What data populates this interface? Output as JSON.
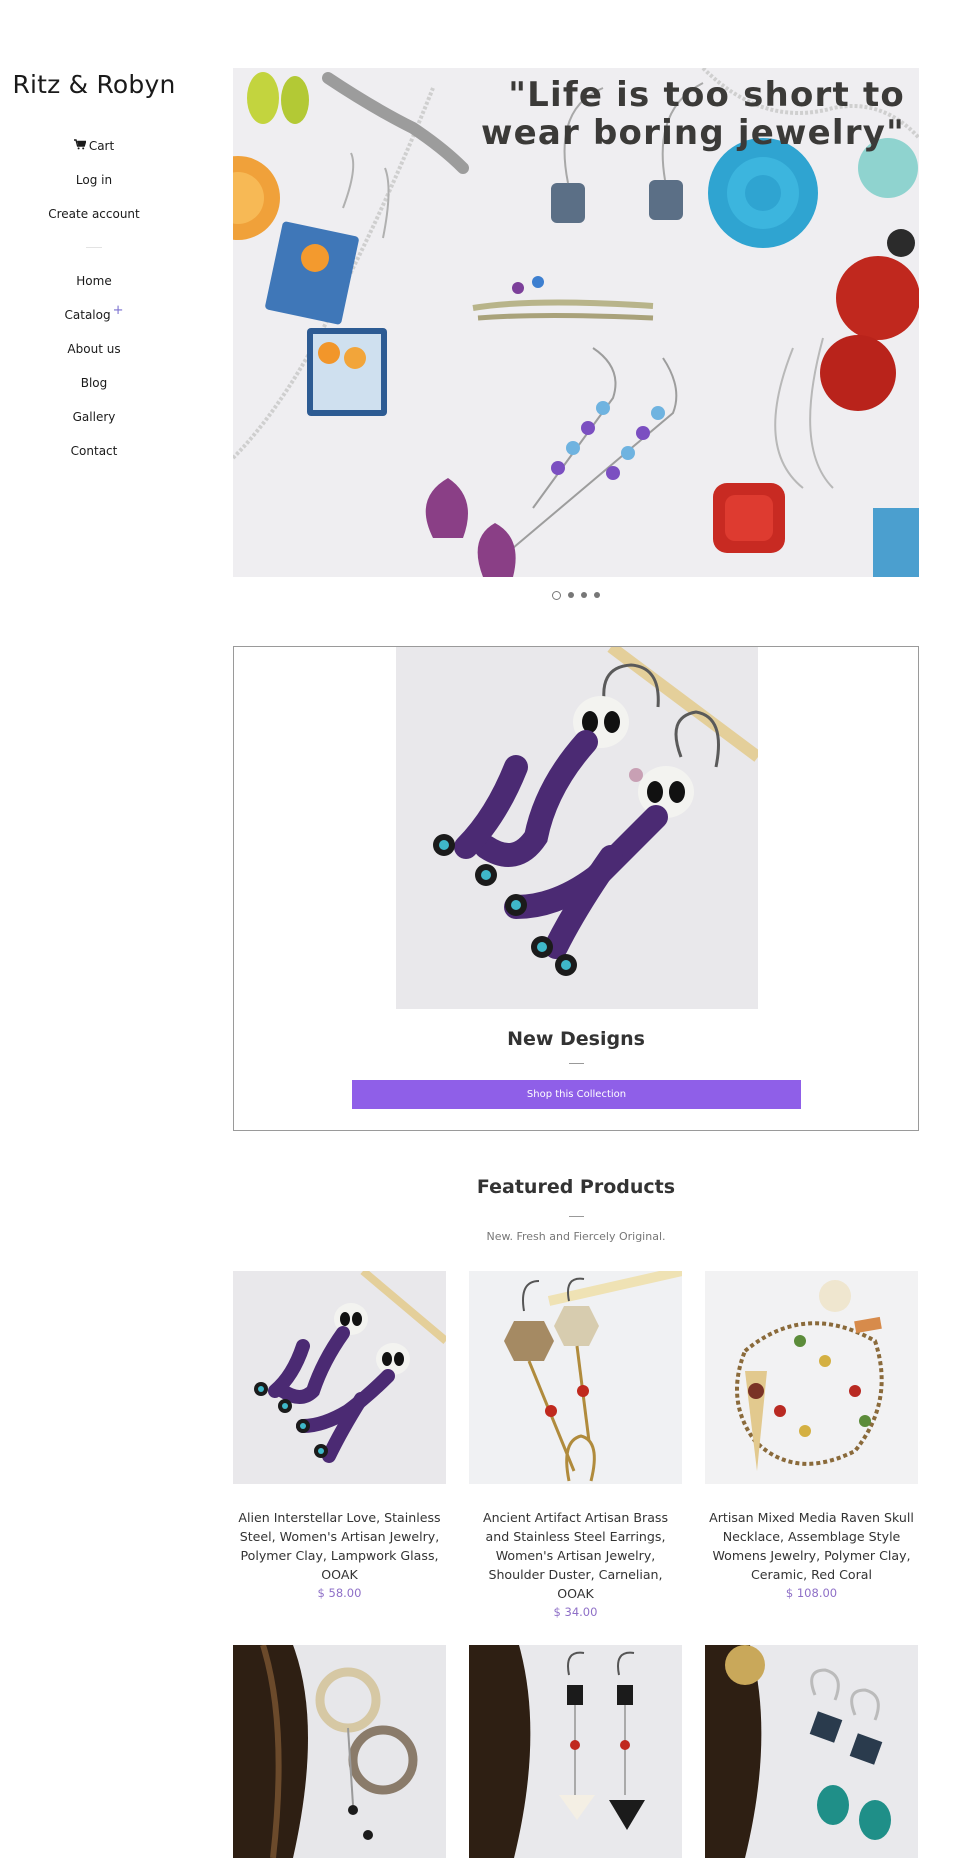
{
  "site": {
    "logo": "Ritz & Robyn"
  },
  "sidebar": {
    "account": [
      {
        "label": "Cart",
        "icon": "cart-icon"
      },
      {
        "label": "Log in"
      },
      {
        "label": "Create account"
      }
    ],
    "nav": [
      {
        "label": "Home"
      },
      {
        "label": "Catalog",
        "expand": "+"
      },
      {
        "label": "About us"
      },
      {
        "label": "Blog"
      },
      {
        "label": "Gallery"
      },
      {
        "label": "Contact"
      }
    ]
  },
  "hero": {
    "quote_line1": "\"Life is too short to",
    "quote_line2": "wear boring jewelry\"",
    "slide_count": 4,
    "active_slide": 1
  },
  "collection": {
    "title": "New Designs",
    "button_label": "Shop this Collection",
    "button_color": "#8f5fe8"
  },
  "featured": {
    "title": "Featured Products",
    "subtitle": "New. Fresh and Fiercely Original.",
    "products": [
      {
        "name": "Alien Interstellar Love, Stainless Steel, Women's Artisan Jewelry, Polymer Clay, Lampwork Glass, OOAK",
        "price": "$ 58.00"
      },
      {
        "name": "Ancient Artifact Artisan Brass and Stainless Steel Earrings, Women's Artisan Jewelry, Shoulder Duster, Carnelian, OOAK",
        "price": "$ 34.00"
      },
      {
        "name": "Artisan Mixed Media Raven Skull Necklace, Assemblage Style Womens Jewelry, Polymer Clay, Ceramic, Red Coral",
        "price": "$ 108.00"
      }
    ]
  },
  "colors": {
    "accent": "#8f5fe8",
    "price": "#8e6fc7"
  }
}
